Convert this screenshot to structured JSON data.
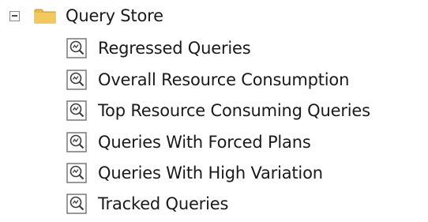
{
  "tree": {
    "root": {
      "label": "Query Store",
      "expander_icon": "collapse-minus-icon",
      "folder_icon": "folder-icon",
      "folder_color": "#E8B94E"
    },
    "children": [
      {
        "label": "Regressed Queries",
        "icon": "report-magnifier-icon"
      },
      {
        "label": "Overall Resource Consumption",
        "icon": "report-magnifier-icon"
      },
      {
        "label": "Top Resource Consuming Queries",
        "icon": "report-magnifier-icon"
      },
      {
        "label": "Queries With Forced Plans",
        "icon": "report-magnifier-icon"
      },
      {
        "label": "Queries With High Variation",
        "icon": "report-magnifier-icon"
      },
      {
        "label": "Tracked Queries",
        "icon": "report-magnifier-icon"
      }
    ]
  }
}
